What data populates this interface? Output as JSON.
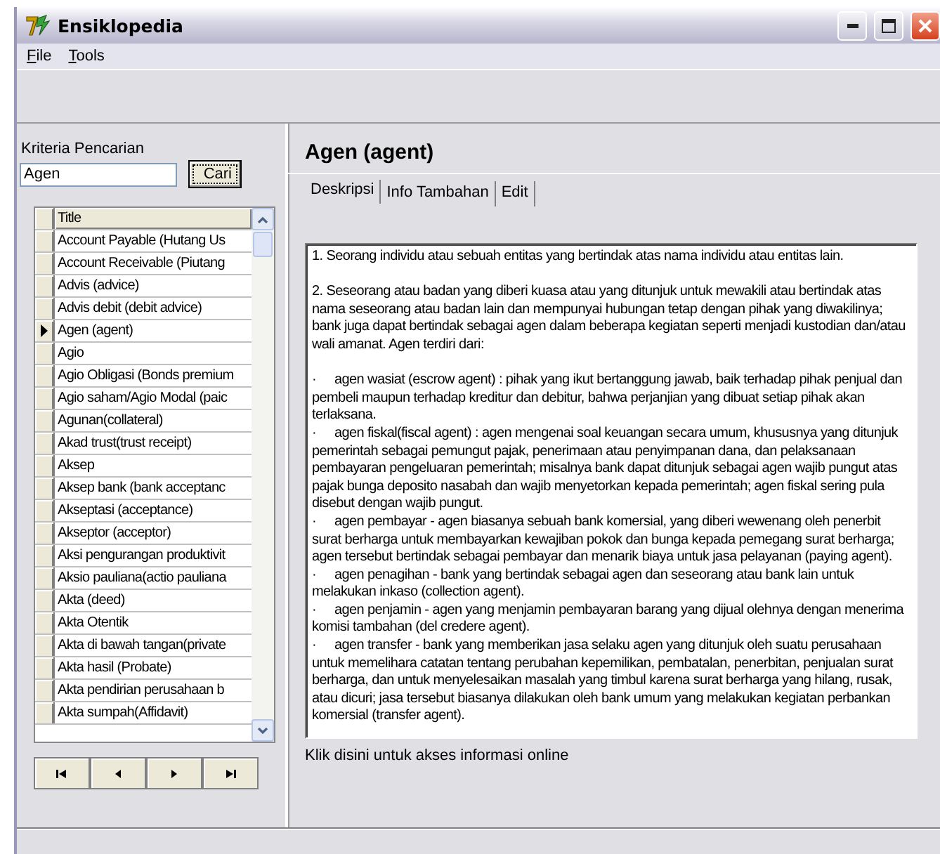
{
  "window": {
    "title": "Ensiklopedia"
  },
  "menu": [
    {
      "label": "File"
    },
    {
      "label": "Tools"
    }
  ],
  "search": {
    "label": "Kriteria Pencarian",
    "value": "Agen",
    "button": "Cari"
  },
  "grid": {
    "column": "Title",
    "rows": [
      {
        "title": "Account Payable (Hutang Us",
        "selected": false
      },
      {
        "title": "Account Receivable (Piutang",
        "selected": false
      },
      {
        "title": "Advis (advice)",
        "selected": false
      },
      {
        "title": "Advis debit (debit advice)",
        "selected": false
      },
      {
        "title": "Agen (agent)",
        "selected": true
      },
      {
        "title": "Agio",
        "selected": false
      },
      {
        "title": "Agio Obligasi (Bonds premium",
        "selected": false
      },
      {
        "title": "Agio saham/Agio Modal (paic",
        "selected": false
      },
      {
        "title": "Agunan(collateral)",
        "selected": false
      },
      {
        "title": "Akad trust(trust receipt)",
        "selected": false
      },
      {
        "title": "Aksep",
        "selected": false
      },
      {
        "title": "Aksep bank (bank acceptanc",
        "selected": false
      },
      {
        "title": "Akseptasi (acceptance)",
        "selected": false
      },
      {
        "title": "Akseptor (acceptor)",
        "selected": false
      },
      {
        "title": "Aksi pengurangan produktivit",
        "selected": false
      },
      {
        "title": "Aksio pauliana(actio pauliana",
        "selected": false
      },
      {
        "title": "Akta (deed)",
        "selected": false
      },
      {
        "title": "Akta Otentik",
        "selected": false
      },
      {
        "title": "Akta di bawah tangan(private",
        "selected": false
      },
      {
        "title": "Akta hasil (Probate)",
        "selected": false
      },
      {
        "title": "Akta pendirian perusahaan b",
        "selected": false
      },
      {
        "title": "Akta sumpah(Affidavit)",
        "selected": false
      }
    ]
  },
  "navigator": [
    {
      "kind": "first"
    },
    {
      "kind": "prior"
    },
    {
      "kind": "next"
    },
    {
      "kind": "last"
    }
  ],
  "entry": {
    "title": "Agen (agent)"
  },
  "tabs": [
    {
      "label": "Deskripsi",
      "selected": true
    },
    {
      "label": "Info Tambahan",
      "selected": false
    },
    {
      "label": "Edit",
      "selected": false
    }
  ],
  "description": [
    {
      "kind": "paragraph",
      "text": "1.  Seorang individu atau sebuah entitas yang bertindak atas nama individu atau entitas lain."
    },
    {
      "kind": "paragraph",
      "text": "2.  Seseorang atau badan yang diberi kuasa atau yang ditunjuk untuk mewakili atau bertindak atas nama seseorang atau badan lain dan mempunyai hubungan tetap dengan pihak yang diwakilinya; bank juga dapat bertindak sebagai agen dalam beberapa kegiatan seperti menjadi kustodian dan/atau wali amanat. Agen terdiri dari:"
    },
    {
      "kind": "bullet",
      "bullet": "·",
      "text": "agen wasiat (escrow agent) : pihak yang ikut bertanggung jawab, baik terhadap pihak penjual dan pembeli maupun terhadap kreditur dan debitur, bahwa perjanjian yang dibuat setiap pihak akan terlaksana."
    },
    {
      "kind": "bullet",
      "bullet": "·",
      "text": "agen fiskal(fiscal agent) : agen mengenai soal keuangan secara umum, khususnya yang ditunjuk pemerintah sebagai pemungut pajak, penerimaan atau penyimpanan dana, dan pelaksanaan pembayaran pengeluaran pemerintah; misalnya bank dapat ditunjuk sebagai agen wajib pungut atas pajak bunga deposito nasabah dan wajib menyetorkan kepada pemerintah; agen fiskal sering pula disebut dengan wajib pungut."
    },
    {
      "kind": "bullet",
      "bullet": "·",
      "text": "agen pembayar - agen biasanya sebuah bank komersial, yang diberi wewenang oleh penerbit surat berharga untuk membayarkan kewajiban pokok dan bunga kepada pemegang surat berharga; agen tersebut bertindak sebagai pembayar dan menarik biaya untuk jasa pelayanan (paying agent)."
    },
    {
      "kind": "bullet",
      "bullet": "·",
      "text": "agen penagihan - bank yang bertindak sebagai agen dan seseorang atau bank lain untuk melakukan inkaso (collection agent)."
    },
    {
      "kind": "bullet",
      "bullet": "·",
      "text": "agen penjamin - agen yang menjamin pembayaran barang yang dijual olehnya dengan menerima komisi tambahan (del credere agent)."
    },
    {
      "kind": "bullet",
      "bullet": "·",
      "text": "agen transfer - bank yang memberikan jasa selaku agen yang ditunjuk oleh suatu perusahaan untuk memelihara catatan tentang perubahan kepemilikan, pembatalan, penerbitan, penjualan surat berharga, dan untuk menyelesaikan masalah yang timbul karena surat berharga yang hilang, rusak, atau dicuri; jasa tersebut biasanya dilakukan oleh bank umum yang melakukan kegiatan perbankan komersial (transfer agent)."
    }
  ],
  "online_link": "Klik disini untuk akses informasi online"
}
